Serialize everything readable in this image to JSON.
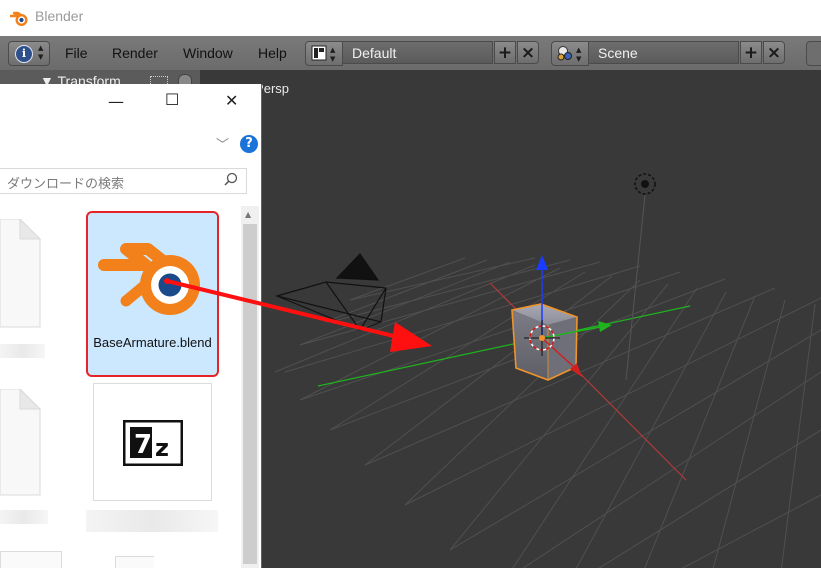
{
  "window": {
    "title": "Blender"
  },
  "menu": {
    "file": "File",
    "render": "Render",
    "window": "Window",
    "help": "Help"
  },
  "layout_selector": {
    "value": "Default",
    "add": "+",
    "remove": "×"
  },
  "scene_selector": {
    "value": "Scene",
    "add": "+",
    "remove": "×"
  },
  "editor_type": {
    "icon": "i"
  },
  "transform_panel": {
    "label": "▼ Transform"
  },
  "viewport": {
    "label": "User Persp"
  },
  "explorer": {
    "minimize": "—",
    "maximize": "☐",
    "close": "✕",
    "help": "?",
    "search_placeholder": "ダウンロードの検索",
    "blend_file_name": "BaseArmature.blend",
    "zip_icon_text": "7z"
  },
  "colors": {
    "blender_orange": "#f2801b",
    "blender_blue": "#1a4a8a",
    "highlight_border": "#e62426",
    "selection_bg": "#cce8ff",
    "arrow_red": "#ff1010",
    "axis_green": "#1fb31f",
    "axis_blue": "#1a3cff"
  },
  "icons": [
    "blender-logo-icon",
    "info-icon",
    "screen-layout-icon",
    "scene-icon",
    "search-icon",
    "help-icon",
    "lamp-icon",
    "camera-icon",
    "cube-icon",
    "7z-icon"
  ]
}
